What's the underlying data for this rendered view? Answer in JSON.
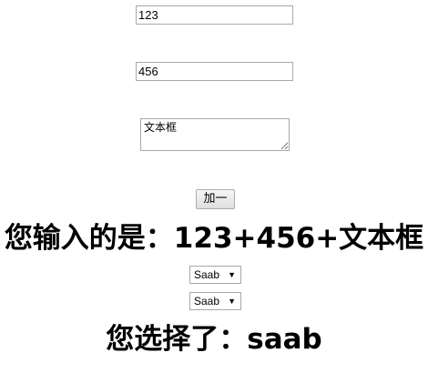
{
  "inputs": {
    "first_value": "123",
    "second_value": "456",
    "textarea_value": "文本框"
  },
  "button": {
    "label": "加一"
  },
  "result": {
    "text": "您输入的是：123+456+文本框"
  },
  "selects": [
    {
      "selected": "Saab",
      "arrow_icon": "▼"
    },
    {
      "selected": "Saab",
      "arrow_icon": "▼"
    }
  ],
  "selection": {
    "text": "您选择了：saab"
  }
}
